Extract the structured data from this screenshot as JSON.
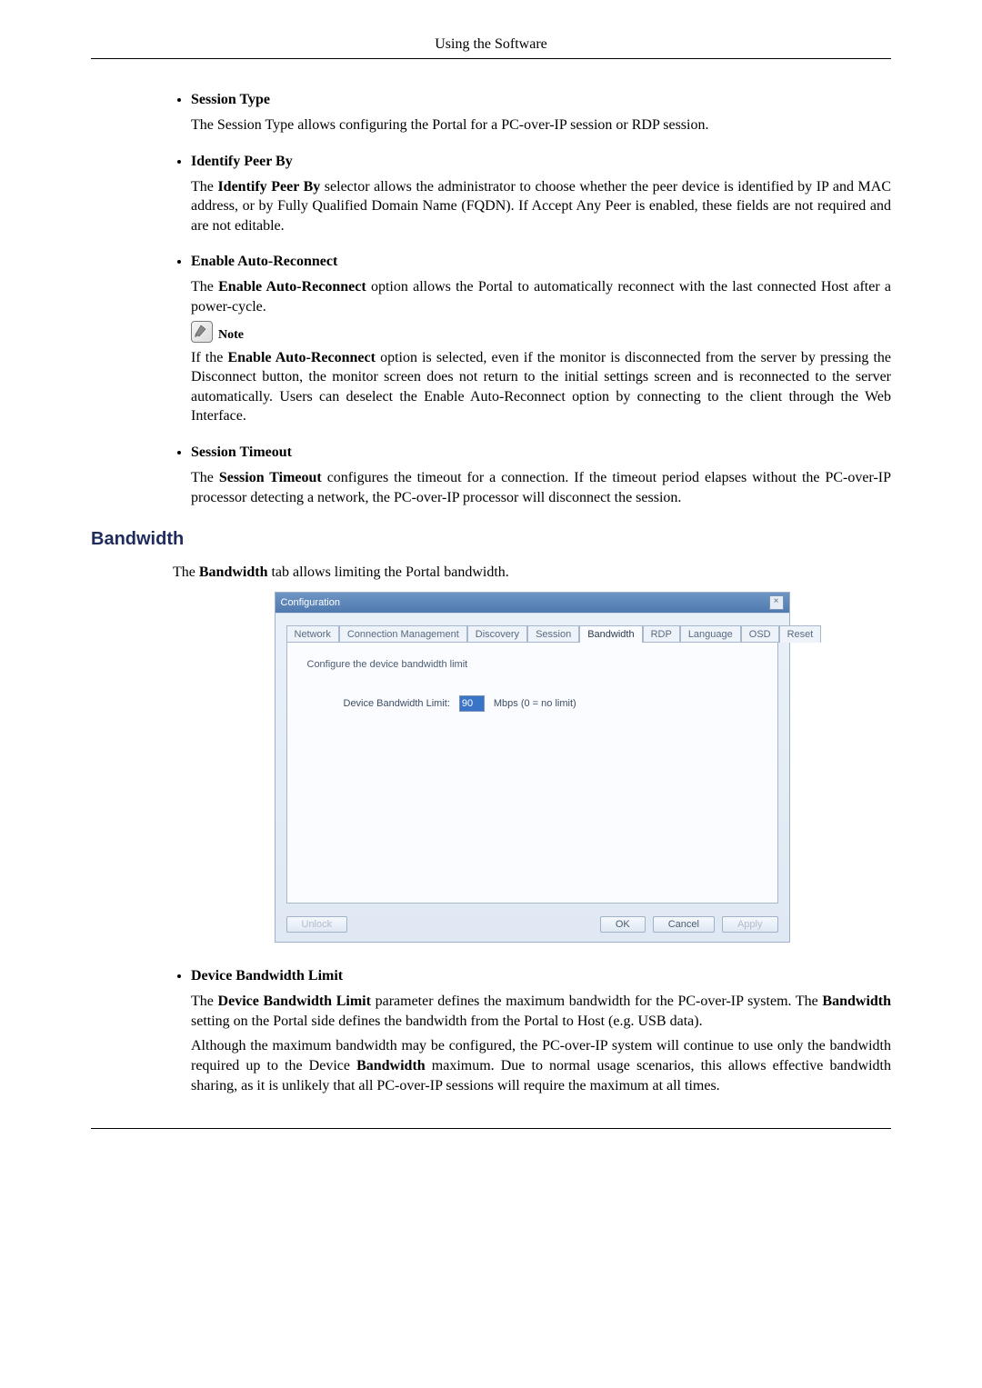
{
  "header": {
    "title": "Using the Software"
  },
  "sections": {
    "session_type": {
      "title": "Session Type",
      "para": "The Session Type allows configuring the Portal for a PC-over-IP session or RDP session."
    },
    "identify_peer": {
      "title": "Identify Peer By",
      "para_prefix": "The ",
      "para_bold": "Identify Peer By",
      "para_rest": " selector allows the administrator to choose whether the peer device is identified by IP and MAC address, or by Fully Qualified Domain Name (FQDN). If Accept Any Peer is enabled, these fields are not required and are not editable."
    },
    "auto_reconnect": {
      "title": "Enable Auto-Reconnect",
      "p1_prefix": "The ",
      "p1_bold": "Enable Auto-Reconnect",
      "p1_rest": " option allows the Portal to automatically reconnect with the last connected Host after a power-cycle.",
      "note_label": "Note",
      "p2_prefix": "If the ",
      "p2_bold": "Enable Auto-Reconnect",
      "p2_rest": " option is selected, even if the monitor is disconnected from the server by pressing the Disconnect button, the monitor screen does not return to the initial settings screen and is reconnected to the server automatically. Users can deselect the Enable Auto-Reconnect option by connecting to the client through the Web Interface."
    },
    "session_timeout": {
      "title": "Session Timeout",
      "p_prefix": "The ",
      "p_bold": "Session Timeout",
      "p_rest": " configures the timeout for a connection. If the timeout period elapses without the PC-over-IP processor detecting a network, the PC-over-IP processor will disconnect the session."
    }
  },
  "bandwidth_heading": "Bandwidth",
  "bandwidth_intro_prefix": "The ",
  "bandwidth_intro_bold": "Bandwidth",
  "bandwidth_intro_rest": " tab allows limiting the Portal bandwidth.",
  "dialog": {
    "title": "Configuration",
    "tabs": [
      "Network",
      "Connection Management",
      "Discovery",
      "Session",
      "Bandwidth",
      "RDP",
      "Language",
      "OSD",
      "Reset"
    ],
    "active_tab_index": 4,
    "instruction": "Configure the device bandwidth limit",
    "field_label": "Device Bandwidth Limit:",
    "field_value": "90",
    "field_suffix": "Mbps (0 = no limit)",
    "buttons": {
      "unlock": "Unlock",
      "ok": "OK",
      "cancel": "Cancel",
      "apply": "Apply"
    }
  },
  "device_bw": {
    "title": "Device Bandwidth Limit",
    "p1_prefix": "The ",
    "p1_bold1": "Device Bandwidth Limit",
    "p1_mid": " parameter defines the maximum bandwidth for the PC-over-IP system. The ",
    "p1_bold2": "Bandwidth",
    "p1_rest": " setting on the Portal side defines the bandwidth from the Portal to Host (e.g. USB data).",
    "p2_prefix": "Although the maximum bandwidth may be configured, the PC-over-IP system will continue to use only the bandwidth required up to the Device ",
    "p2_bold": "Bandwidth",
    "p2_rest": " maximum. Due to normal usage scenarios, this allows effective bandwidth sharing, as it is unlikely that all PC-over-IP sessions will require the maximum at all times."
  }
}
